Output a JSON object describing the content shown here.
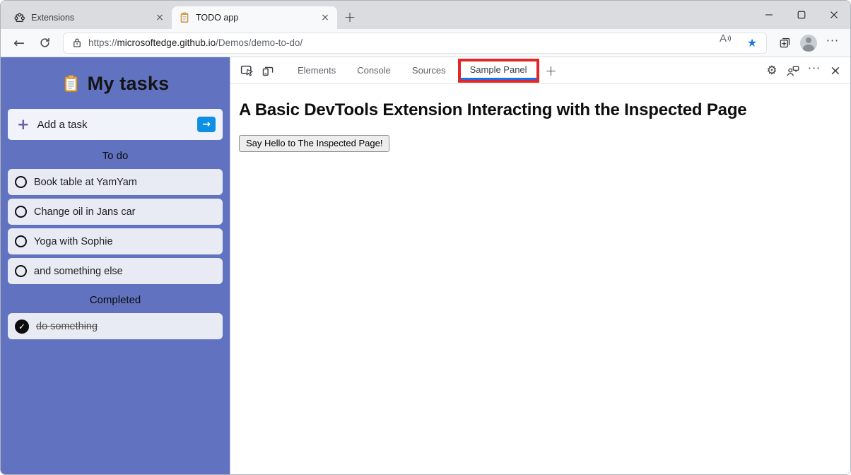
{
  "browser": {
    "tabs": [
      {
        "label": "Extensions",
        "active": false
      },
      {
        "label": "TODO app",
        "active": true
      }
    ],
    "url": {
      "scheme": "https://",
      "host": "microsoftedge.github.io",
      "path": "/Demos/demo-to-do/"
    }
  },
  "icons": {
    "back": "←",
    "star": "★",
    "more": "···",
    "new_tab": "+",
    "tab_close": "×",
    "read_aloud": "A",
    "add_plus": "+",
    "submit_arrow": "→",
    "check": "✓",
    "settings": "⚙",
    "dt_more": "···",
    "dt_close": "×",
    "dt_add": "+"
  },
  "todo": {
    "title": "My tasks",
    "add_task_label": "Add a task",
    "sections": [
      {
        "label": "To do",
        "items": [
          {
            "label": "Book table at YamYam",
            "done": false
          },
          {
            "label": "Change oil in Jans car",
            "done": false
          },
          {
            "label": "Yoga with Sophie",
            "done": false
          },
          {
            "label": "and something else",
            "done": false
          }
        ]
      },
      {
        "label": "Completed",
        "items": [
          {
            "label": "do something",
            "done": true
          }
        ]
      }
    ]
  },
  "devtools": {
    "tabs": [
      {
        "label": "Elements",
        "active": false
      },
      {
        "label": "Console",
        "active": false
      },
      {
        "label": "Sources",
        "active": false
      },
      {
        "label": "Sample Panel",
        "active": true,
        "highlighted": true
      }
    ],
    "panel": {
      "heading": "A Basic DevTools Extension Interacting with the Inspected Page",
      "button_label": "Say Hello to The Inspected Page!"
    }
  },
  "colors": {
    "sidebar": "#6173c0",
    "accent_blue": "#0f8fe3",
    "favorite_star": "#1a73e8",
    "tab_underline": "#1a73e8",
    "highlight_red": "#e12727"
  }
}
